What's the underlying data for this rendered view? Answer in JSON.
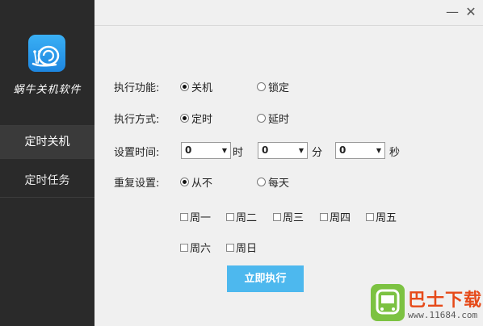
{
  "app": {
    "name": "蜗牛关机软件",
    "logo_icon": "snail-icon",
    "accent_color": "#4db8ee"
  },
  "sidebar": {
    "items": [
      {
        "label": "定时关机",
        "active": true
      },
      {
        "label": "定时任务",
        "active": false
      }
    ]
  },
  "window": {
    "minimize_glyph": "—",
    "close_glyph": "✕"
  },
  "form": {
    "function": {
      "label": "执行功能:",
      "options": [
        {
          "label": "关机",
          "selected": true
        },
        {
          "label": "锁定",
          "selected": false
        }
      ]
    },
    "mode": {
      "label": "执行方式:",
      "options": [
        {
          "label": "定时",
          "selected": true
        },
        {
          "label": "延时",
          "selected": false
        }
      ]
    },
    "time": {
      "label": "设置时间:",
      "hour": {
        "value": "0",
        "unit": "时"
      },
      "minute": {
        "value": "0",
        "unit": "分"
      },
      "second": {
        "value": "0",
        "unit": "秒"
      }
    },
    "repeat": {
      "label": "重复设置:",
      "options": [
        {
          "label": "从不",
          "selected": true
        },
        {
          "label": "每天",
          "selected": false
        }
      ],
      "days": [
        {
          "label": "周一",
          "checked": false
        },
        {
          "label": "周二",
          "checked": false
        },
        {
          "label": "周三",
          "checked": false
        },
        {
          "label": "周四",
          "checked": false
        },
        {
          "label": "周五",
          "checked": false
        },
        {
          "label": "周六",
          "checked": false
        },
        {
          "label": "周日",
          "checked": false
        }
      ]
    },
    "execute_label": "立即执行"
  },
  "watermark": {
    "text": "巴士下载",
    "url": "www.11684.com"
  }
}
